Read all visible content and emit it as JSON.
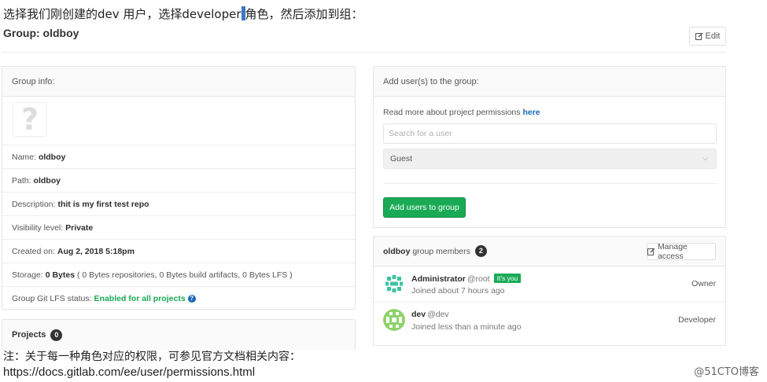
{
  "blog": {
    "intro_part1": "选择我们刚创建的dev 用户，选择developer",
    "intro_part2": "角色，然后添加到组：",
    "note_line1": "注：关于每一种角色对应的权限，可参见官方文档相关内容：",
    "note_line2": "https://docs.gitlab.com/ee/user/permissions.html",
    "watermark": "@51CTO博客"
  },
  "header": {
    "title": "Group: oldboy",
    "edit_label": "Edit"
  },
  "group_info": {
    "heading": "Group info:",
    "name_label": "Name:",
    "name_value": "oldboy",
    "path_label": "Path:",
    "path_value": "oldboy",
    "description_label": "Description:",
    "description_value": "thit is my first test repo",
    "visibility_label": "Visibility level:",
    "visibility_value": "Private",
    "created_label": "Created on:",
    "created_value": "Aug 2, 2018 5:18pm",
    "storage_label": "Storage:",
    "storage_value": "0 Bytes",
    "storage_detail": "( 0 Bytes repositories, 0 Bytes build artifacts, 0 Bytes LFS )",
    "lfs_label": "Group Git LFS status:",
    "lfs_value": "Enabled for all projects"
  },
  "projects": {
    "heading": "Projects",
    "count": "0"
  },
  "add_users": {
    "heading": "Add user(s) to the group:",
    "permissions_text": "Read more about project permissions",
    "permissions_link": "here",
    "search_placeholder": "Search for a user",
    "role_selected": "Guest",
    "add_button": "Add users to group"
  },
  "members": {
    "group_name": "oldboy",
    "heading_suffix": "group members",
    "count": "2",
    "manage_label": "Manage access",
    "items": [
      {
        "name": "Administrator",
        "username": "@root",
        "badge": "It's you",
        "joined": "Joined about 7 hours ago",
        "role": "Owner"
      },
      {
        "name": "dev",
        "username": "@dev",
        "joined": "Joined less than a minute ago",
        "role": "Developer"
      }
    ]
  },
  "colors": {
    "accent_green": "#1aaa55",
    "link_blue": "#1b69b6"
  }
}
